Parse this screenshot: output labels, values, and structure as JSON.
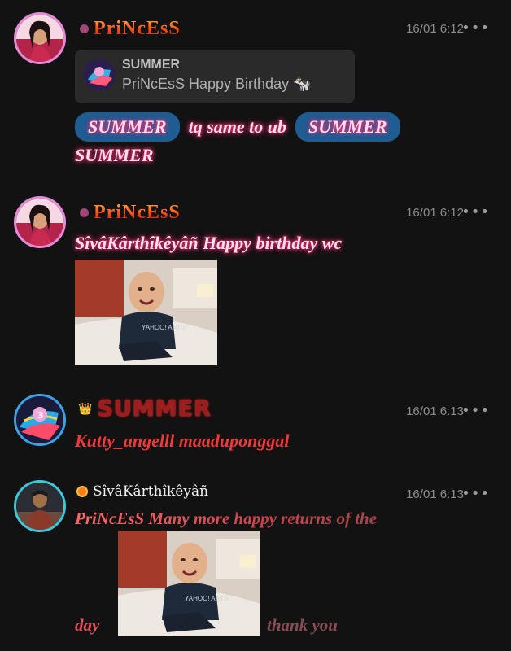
{
  "messages": [
    {
      "author": "PriNcEsS",
      "time": "16/01 6:12",
      "more": "•••",
      "quote": {
        "name": "SUMMER",
        "text": "PriNcEsS Happy Birthday 🐄"
      },
      "mention1": "SUMMER",
      "text_mid": "tq same to ub",
      "mention2": "SUMMER",
      "text_end": "SUMMER"
    },
    {
      "author": "PriNcEsS",
      "time": "16/01 6:12",
      "more": "•••",
      "text": "SîvâKârthîkêyâñ Happy birthday wc",
      "gif_label": "YAHOO! ARTS"
    },
    {
      "author": "SUMMER",
      "author_badge": "👑",
      "time": "16/01 6:13",
      "more": "•••",
      "text": "Kutty_angelll maaduponggal"
    },
    {
      "author": "SîvâKârthîkêyâñ",
      "time": "16/01 6:13",
      "more": "•••",
      "text_line1": "PriNcEsS Many more happy returns of the",
      "text_day": "day",
      "text_end": "thank you",
      "gif_label": "YAHOO! ARTS"
    }
  ],
  "colors": {
    "background": "#121212",
    "pill": "#1e5c91",
    "glow": "#ff2c7a"
  }
}
